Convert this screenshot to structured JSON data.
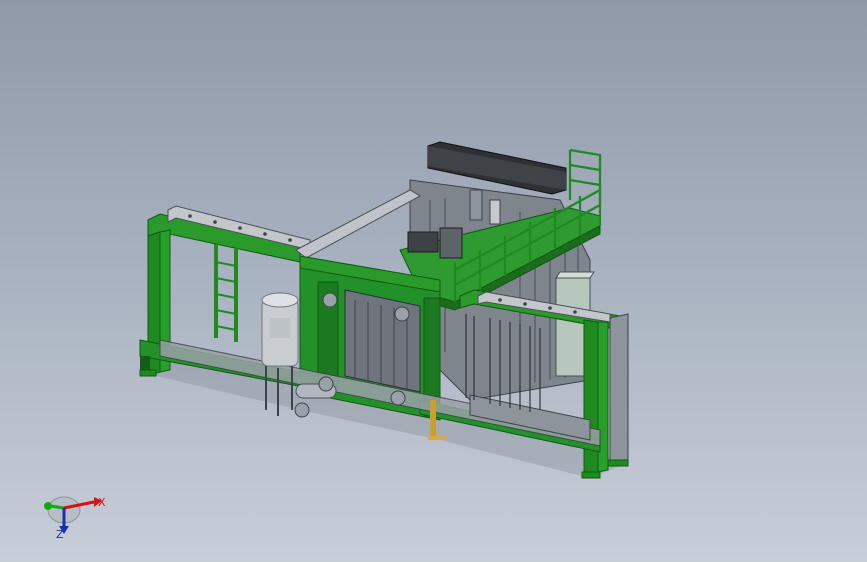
{
  "viewport": {
    "name": "cad-3d-viewport"
  },
  "triad": {
    "x_label": "X",
    "z_label": "Z",
    "colors": {
      "x_axis": "#d81010",
      "y_axis": "#15a815",
      "z_axis": "#1a2fb0"
    }
  },
  "model": {
    "colors": {
      "frame_green": "#1f8a1f",
      "frame_dark": "#0f5a12",
      "steel_gray": "#8d949c",
      "dark_gray": "#3d4247",
      "rail_gray": "#b8bcc2",
      "tank": "#c9cdd2"
    }
  }
}
